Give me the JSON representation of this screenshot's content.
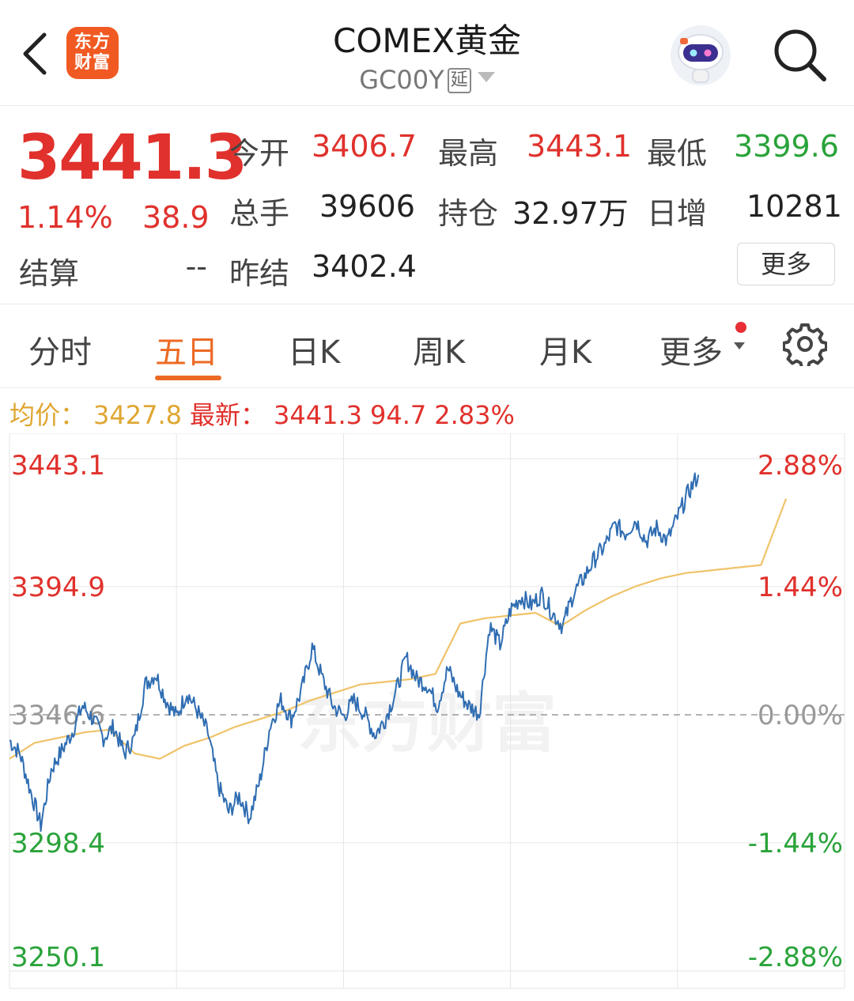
{
  "header": {
    "title": "COMEX黄金",
    "code": "GC00Y",
    "delay_tag": "延",
    "logo_line1": "东方",
    "logo_line2": "财富"
  },
  "quote": {
    "price": "3441.3",
    "change_pct": "1.14%",
    "change_abs": "38.9",
    "settle_label": "结算",
    "settle_value": "--",
    "open_label": "今开",
    "open_value": "3406.7",
    "high_label": "最高",
    "high_value": "3443.1",
    "low_label": "最低",
    "low_value": "3399.6",
    "volume_label": "总手",
    "volume_value": "39606",
    "oi_label": "持仓",
    "oi_value": "32.97万",
    "daily_inc_label": "日增",
    "daily_inc_value": "10281",
    "prev_settle_label": "昨结",
    "prev_settle_value": "3402.4",
    "more_label": "更多"
  },
  "tabs": {
    "intraday": "分时",
    "five_day": "五日",
    "daily_k": "日K",
    "weekly_k": "周K",
    "monthly_k": "月K",
    "more": "更多",
    "active": "五日"
  },
  "info_line": {
    "avg_label": "均价：",
    "avg_value": "3427.8",
    "latest_label": "最新：",
    "latest_value": "3441.3",
    "change_abs": "94.7",
    "change_pct": "2.83%"
  },
  "colors": {
    "up": "#e0312c",
    "down": "#2aa33a",
    "accent": "#ec6a25",
    "price_line": "#2f6db2",
    "avg_line": "#f0c36a"
  },
  "chart_data": {
    "type": "line",
    "y_ticks_left": [
      "3443.1",
      "3394.9",
      "3346.6",
      "3298.4",
      "3250.1"
    ],
    "y_ticks_right": [
      "2.88%",
      "1.44%",
      "0.00%",
      "-1.44%",
      "-2.88%"
    ],
    "ylim": [
      3250.1,
      3443.1
    ],
    "base": 3346.6,
    "days": 5,
    "watermark": "东方财富",
    "series": [
      {
        "role": "price",
        "values": [
          3337,
          3332,
          3318,
          3305,
          3326,
          3333,
          3340,
          3350,
          3345,
          3338,
          3342,
          3332,
          3338,
          3358,
          3362,
          3352,
          3346,
          3355,
          3348,
          3340,
          3320,
          3310,
          3316,
          3308,
          3322,
          3343,
          3352,
          3345,
          3356,
          3372,
          3360,
          3350,
          3346,
          3352,
          3347,
          3339,
          3345,
          3355,
          3368,
          3360,
          3358,
          3350,
          3364,
          3355,
          3350,
          3347,
          3380,
          3373,
          3386,
          3391,
          3388,
          3392,
          3385,
          3380,
          3392,
          3398,
          3405,
          3410,
          3418,
          3415,
          3420,
          3412,
          3417,
          3412,
          3421,
          3430,
          3437
        ]
      },
      {
        "role": "average",
        "values": [
          3330,
          3336,
          3338,
          3340,
          3341,
          3332,
          3330,
          3335,
          3338,
          3342,
          3345,
          3348,
          3352,
          3355,
          3358,
          3359,
          3360,
          3362,
          3381,
          3383,
          3384,
          3385,
          3380,
          3386,
          3391,
          3395,
          3398,
          3400,
          3401,
          3402,
          3403,
          3428
        ]
      }
    ]
  }
}
